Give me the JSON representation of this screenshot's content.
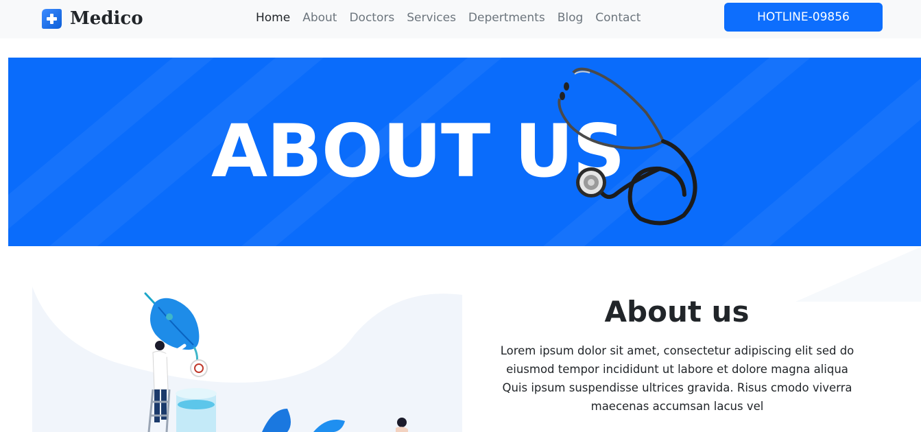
{
  "brand": {
    "name": "Medico"
  },
  "nav": {
    "items": [
      {
        "label": "Home",
        "active": true
      },
      {
        "label": "About",
        "active": false
      },
      {
        "label": "Doctors",
        "active": false
      },
      {
        "label": "Services",
        "active": false
      },
      {
        "label": "Depertments",
        "active": false
      },
      {
        "label": "Blog",
        "active": false
      },
      {
        "label": "Contact",
        "active": false
      }
    ],
    "hotline_label": "HOTLINE-09856"
  },
  "hero": {
    "title": "ABOUT US"
  },
  "about": {
    "heading": "About us",
    "paragraph": "Lorem ipsum dolor sit amet, consectetur adipiscing elit sed do eiusmod tempor incididunt ut labore et dolore magna aliqua Quis ipsum suspendisse ultrices gravida. Risus cmodo viverra maecenas accumsan lacus vel"
  },
  "colors": {
    "primary": "#0d6efd",
    "hero_bg": "#0a6cfb",
    "navbar_bg": "#f8f9fa",
    "text_dark": "#212529",
    "text_muted": "#6c757d"
  },
  "icons": {
    "brand": "medical-cross-icon",
    "hero_decoration": "stethoscope-icon",
    "illustration": "laboratory-illustration"
  }
}
